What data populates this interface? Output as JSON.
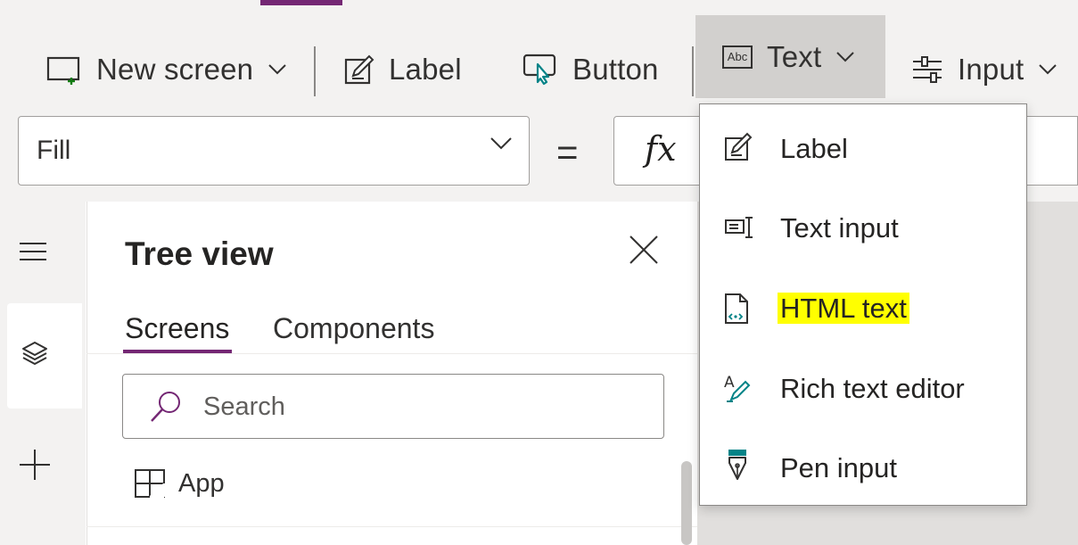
{
  "ribbon": {
    "new_screen_label": "New screen",
    "label_label": "Label",
    "button_label": "Button",
    "text_label": "Text",
    "text_icon_text": "Abc",
    "input_label": "Input"
  },
  "formula_bar": {
    "property_value": "Fill",
    "equals": "=",
    "fx_symbol": "fx"
  },
  "text_menu": {
    "items": [
      {
        "label": "Label",
        "icon": "label-edit-icon"
      },
      {
        "label": "Text input",
        "icon": "text-input-icon"
      },
      {
        "label": "HTML text",
        "icon": "html-text-icon",
        "highlighted": true
      },
      {
        "label": "Rich text editor",
        "icon": "rich-text-icon"
      },
      {
        "label": "Pen input",
        "icon": "pen-input-icon"
      }
    ]
  },
  "tree_view": {
    "title": "Tree view",
    "tabs": [
      {
        "label": "Screens",
        "active": true
      },
      {
        "label": "Components",
        "active": false
      }
    ],
    "search_placeholder": "Search",
    "items": [
      {
        "label": "App",
        "icon": "app-icon"
      }
    ]
  },
  "colors": {
    "accent": "#742774",
    "highlight": "#ffff00",
    "teal_icon": "#038387"
  }
}
